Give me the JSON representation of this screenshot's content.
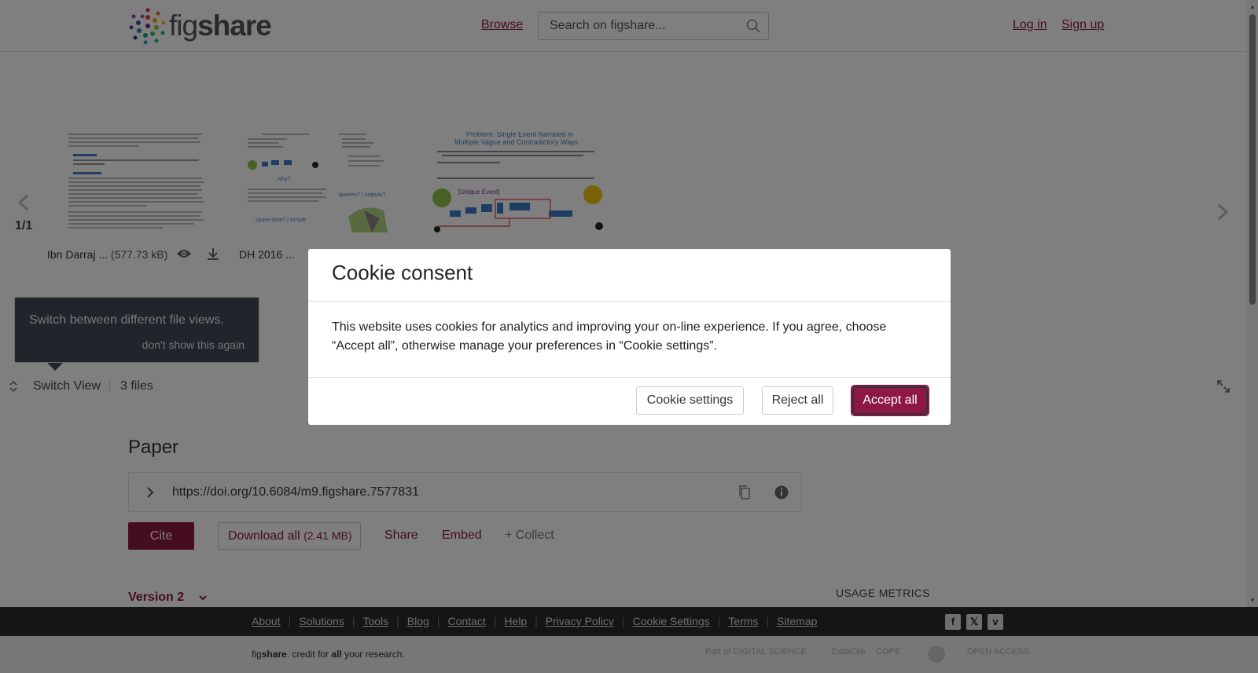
{
  "header": {
    "logo_text_light": "fig",
    "logo_text_bold": "share",
    "browse": "Browse",
    "search_placeholder": "Search on figshare...",
    "login": "Log in",
    "signup": "Sign up"
  },
  "carousel": {
    "pager": "1/1",
    "files": [
      {
        "name": "Ibn Darraj ...",
        "size": "(577.73 kB)"
      },
      {
        "name": "DH 2016 ...",
        "size": ""
      },
      {
        "name": "",
        "size": ""
      }
    ],
    "thumb3_title": "Problem: Single Event Narrated in Multiple Vague and Contradictory Ways",
    "thumb3_label": "[Unique Event]"
  },
  "tooltip": {
    "text": "Switch between different file views.",
    "dismiss": "don't show this again"
  },
  "switch_bar": {
    "label": "Switch View",
    "files_count": "3 files"
  },
  "main": {
    "title": "Paper",
    "doi": "https://doi.org/10.6084/m9.figshare.7577831",
    "cite": "Cite",
    "download_all": "Download all",
    "download_size": "(2.41 MB)",
    "share": "Share",
    "embed": "Embed",
    "collect": "+ Collect",
    "version": "Version 2",
    "usage_metrics": "USAGE METRICS"
  },
  "footer": {
    "links": [
      "About",
      "Solutions",
      "Tools",
      "Blog",
      "Contact",
      "Help",
      "Privacy Policy",
      "Cookie Settings",
      "Terms",
      "Sitemap"
    ],
    "tagline_pre": "fig",
    "tagline_bold": "share",
    "tagline_mid": ". credit for ",
    "tagline_all": "all",
    "tagline_post": " your research.",
    "partners": [
      "Part of DIGITAL SCIENCE",
      "DataCite",
      "COPE",
      "",
      "OPEN ACCESS"
    ]
  },
  "cookie_modal": {
    "title": "Cookie consent",
    "body": "This website uses cookies for analytics and improving your on-line experience. If you agree, choose “Accept all”, otherwise manage your preferences in “Cookie settings”.",
    "settings": "Cookie settings",
    "reject": "Reject all",
    "accept": "Accept all"
  },
  "colors": {
    "brand": "#8c1843",
    "footer_dark": "#2b2b2b"
  }
}
